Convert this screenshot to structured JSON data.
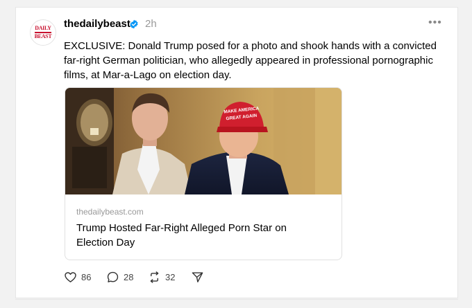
{
  "post": {
    "username": "thedailybeast",
    "time": "2h",
    "avatar_logo_lines": [
      "DAILY",
      "BEAST"
    ],
    "text": "EXCLUSIVE: Donald Trump posed for a photo and shook hands with a convicted far-right German politician, who allegedly appeared in professional pornographic films, at Mar-a-Lago on election day.",
    "link": {
      "domain": "thedailybeast.com",
      "title": "Trump Hosted Far-Right Alleged Porn Star on Election Day",
      "hat_text": [
        "MAKE AMERICA",
        "GREAT AGAIN"
      ]
    },
    "actions": {
      "likes": "86",
      "replies": "28",
      "reposts": "32"
    }
  },
  "colors": {
    "brand_red": "#c8102e",
    "verified_blue": "#0095f6",
    "muted": "#999999"
  },
  "icons": [
    "more-icon",
    "verified-icon",
    "heart-icon",
    "comment-icon",
    "repost-icon",
    "share-icon"
  ]
}
